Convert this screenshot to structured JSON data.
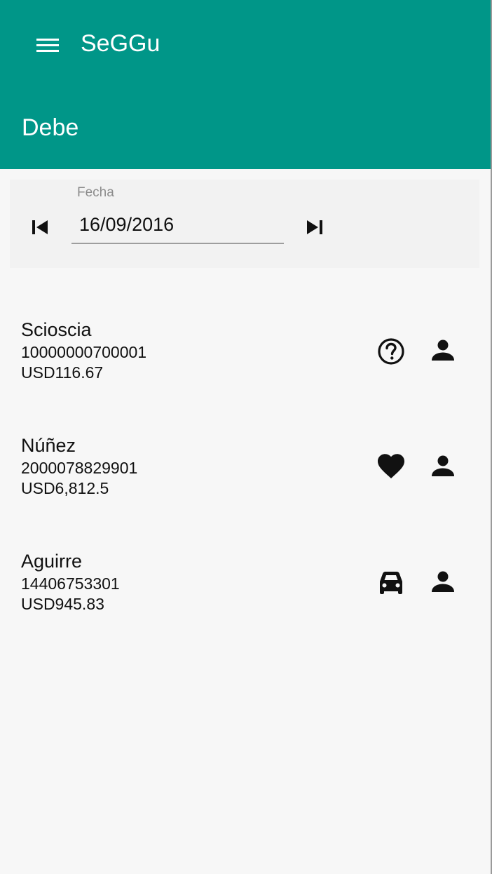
{
  "header": {
    "app_title": "SeGGu",
    "page_title": "Debe"
  },
  "date_filter": {
    "label": "Fecha",
    "value": "16/09/2016"
  },
  "items": [
    {
      "name": "Scioscia",
      "id": "10000000700001",
      "amount": "USD116.67",
      "type_icon": "help-circle-icon"
    },
    {
      "name": "Núñez",
      "id": "2000078829901",
      "amount": "USD6,812.5",
      "type_icon": "heart-icon"
    },
    {
      "name": "Aguirre",
      "id": "14406753301",
      "amount": "USD945.83",
      "type_icon": "car-icon"
    }
  ],
  "colors": {
    "primary": "#009688",
    "background": "#f7f7f7"
  }
}
